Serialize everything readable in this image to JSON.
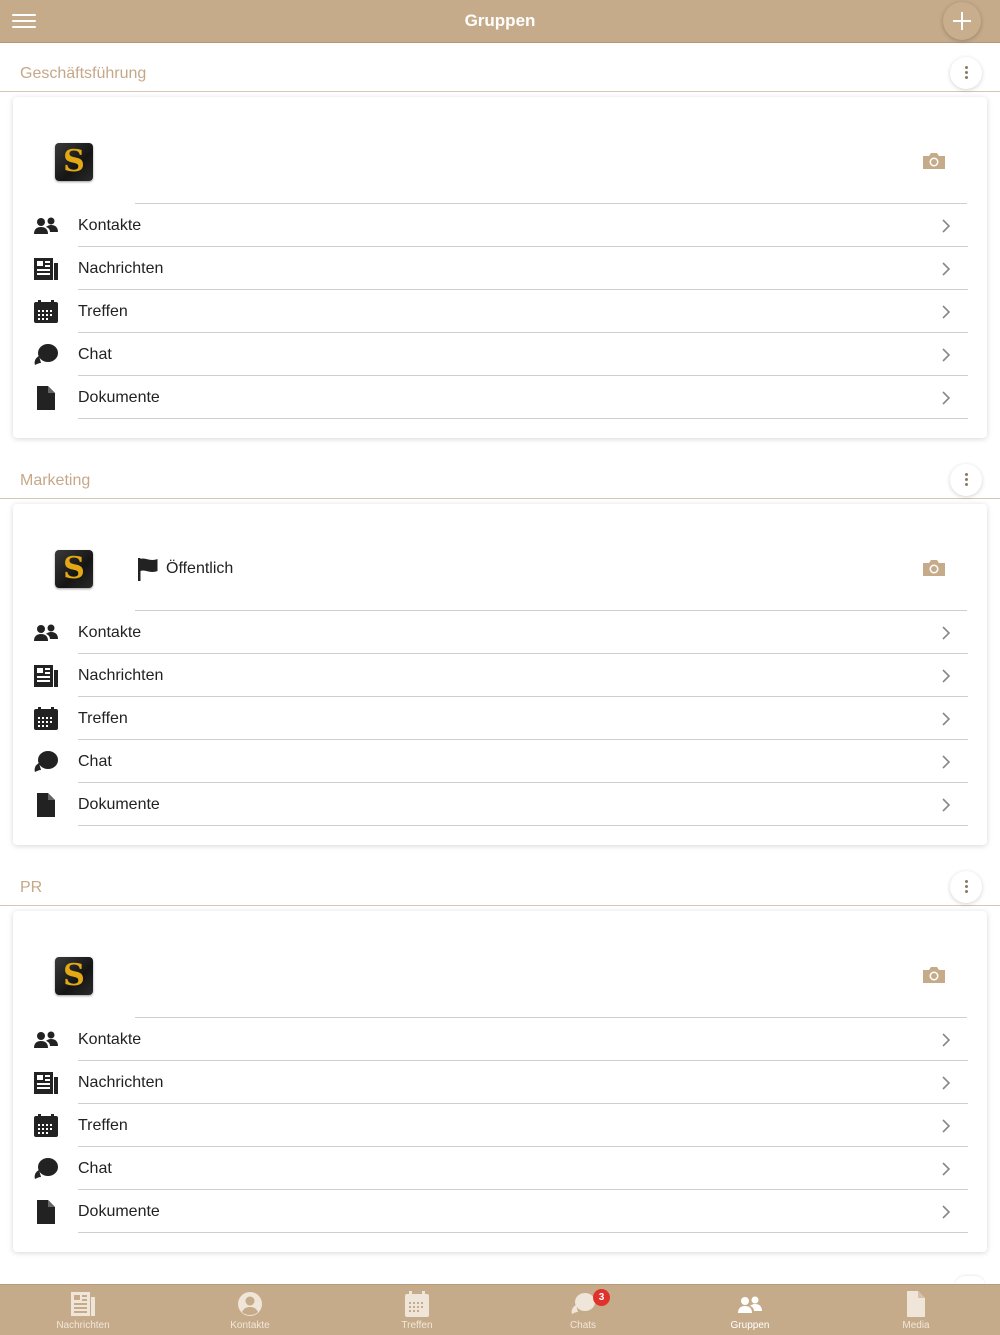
{
  "header": {
    "title": "Gruppen",
    "menu_icon": "hamburger-menu-icon",
    "add_icon": "plus-icon"
  },
  "colors": {
    "brand": "#c6ab8a",
    "group_name": "#c5a888",
    "badge": "#e0312a",
    "text": "#222222"
  },
  "row_labels": {
    "contacts": "Kontakte",
    "news": "Nachrichten",
    "meetings": "Treffen",
    "chat": "Chat",
    "documents": "Dokumente"
  },
  "groups": [
    {
      "name": "Geschäftsführung",
      "logo_letter": "S",
      "public_label": ""
    },
    {
      "name": "Marketing",
      "logo_letter": "S",
      "public_label": "Öffentlich"
    },
    {
      "name": "PR",
      "logo_letter": "S",
      "public_label": ""
    }
  ],
  "tabs": [
    {
      "label": "Nachrichten",
      "icon": "newspaper-icon"
    },
    {
      "label": "Kontakte",
      "icon": "user-circle-icon"
    },
    {
      "label": "Treffen",
      "icon": "calendar-icon"
    },
    {
      "label": "Chats",
      "icon": "chat-bubbles-icon",
      "count": "3"
    },
    {
      "label": "Gruppen",
      "icon": "users-icon",
      "active": true
    },
    {
      "label": "Media",
      "icon": "document-icon"
    }
  ]
}
